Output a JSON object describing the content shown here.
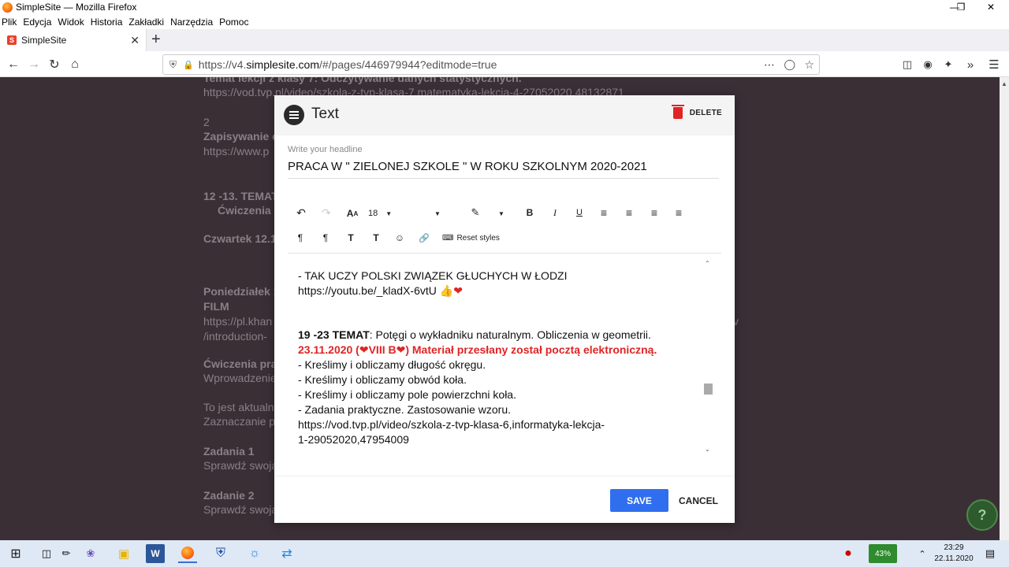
{
  "window": {
    "title": "SimpleSite — Mozilla Firefox"
  },
  "menu": [
    "Plik",
    "Edycja",
    "Widok",
    "Historia",
    "Zakładki",
    "Narzędzia",
    "Pomoc"
  ],
  "tab": {
    "title": "SimpleSite",
    "favicon": "S"
  },
  "url": {
    "prefix": "https://v4.",
    "domain": "simplesite.com",
    "path": "/#/pages/446979944?editmode=true"
  },
  "background_page": {
    "lines": [
      "Temat lekcji z klasy 7: Odczytywanie danych statystycznych.",
      "https://vod.tvp.pl/video/szkola-z-tvp-klasa-7,matematyka-lekcja-4-27052020,48132871",
      "2",
      "Zapisywanie o",
      "https://www.p",
      "12 -13. TEMAT",
      "Ćwiczenia p",
      "Czwartek 12.1",
      "Poniedziałek 1",
      "FILM",
      "https://pl.khan",
      "/introduction-",
      "Ćwiczenia pra",
      "Wprowadzenie",
      "To jest aktualn",
      "Zaznaczanie p",
      "Zadania 1",
      "Sprawdź swoja",
      "Zadanie 2",
      "Sprawdź swoja"
    ],
    "right_fragment": "v"
  },
  "modal": {
    "title": "Text",
    "delete_label": "DELETE",
    "headline_label": "Write your headline",
    "headline_value": "PRACA W \" ZIELONEJ SZKOLE \" W ROKU SZKOLNYM 2020-2021",
    "toolbar": {
      "font_size": "18",
      "reset_styles": "Reset styles",
      "bold": "B",
      "italic": "I",
      "underline": "U"
    },
    "content": {
      "l1": "- TAK UCZY POLSKI ZWIĄZEK GŁUCHYCH W ŁODZI",
      "l2": "https://youtu.be/_kladX-6vtU",
      "l3_bold": "19 -23 TEMAT",
      "l3_rest": ": Potęgi o wykładniku naturalnym. Obliczenia w geometrii.",
      "l4a": "23.11.2020 (",
      "l4b": "VIII B",
      "l4c": ") Materiał przesłany został pocztą elektroniczną.",
      "l5": "- Kreślimy i obliczamy długość okręgu.",
      "l6": "- Kreślimy i obliczamy obwód koła.",
      "l7": "- Kreślimy i obliczamy pole powierzchni koła.",
      "l8": "- Zadania praktyczne. Zastosowanie wzoru.",
      "l9": "https://vod.tvp.pl/video/szkola-z-tvp-klasa-6,informatyka-lekcja-",
      "l10": "1-29052020,47954009"
    },
    "save_label": "SAVE",
    "cancel_label": "CANCEL"
  },
  "help_button": "?",
  "taskbar": {
    "battery": "43%",
    "time": "23:29",
    "date": "22.11.2020",
    "word_icon": "W"
  },
  "colors": {
    "accent": "#2f6fef",
    "red": "#e02424",
    "page_bg": "#3b2f36"
  }
}
